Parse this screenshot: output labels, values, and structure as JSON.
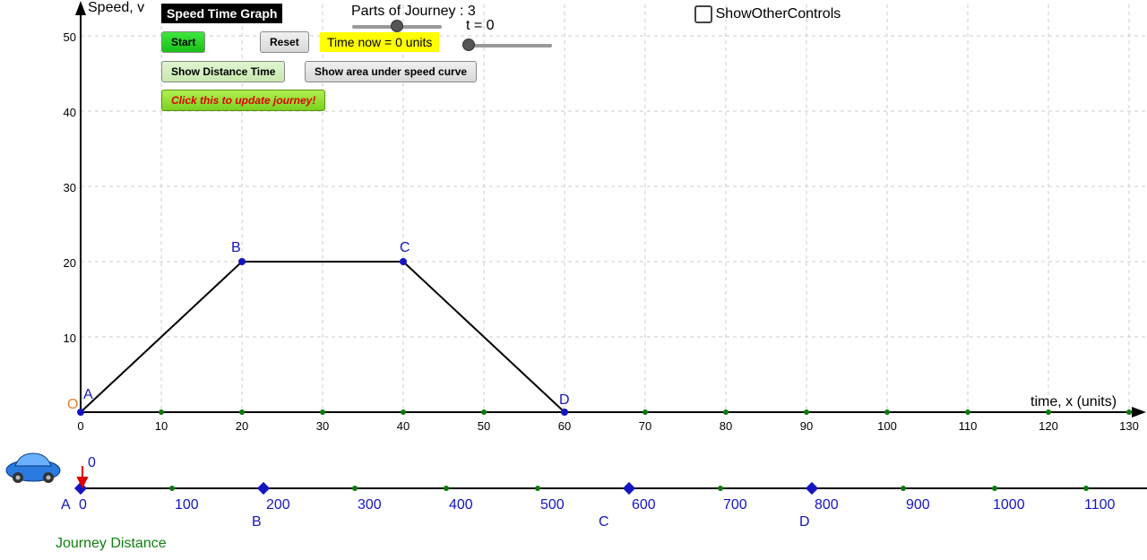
{
  "chart_data": {
    "type": "line",
    "title": "Speed Time Graph",
    "xlabel": "time,  x (units)",
    "ylabel": "Speed, v",
    "x": [
      0,
      20,
      40,
      60
    ],
    "values": [
      0,
      20,
      20,
      0
    ],
    "point_labels": [
      "A",
      "B",
      "C",
      "D"
    ],
    "xlim": [
      0,
      130
    ],
    "ylim": [
      0,
      50
    ],
    "xticks": [
      0,
      10,
      20,
      30,
      40,
      50,
      60,
      70,
      80,
      90,
      100,
      110,
      120,
      130
    ],
    "yticks": [
      10,
      20,
      30,
      40,
      50
    ],
    "origin_label": "O"
  },
  "controls": {
    "title": "Speed Time Graph",
    "start": "Start",
    "reset": "Reset",
    "time_now": "Time now = 0 units",
    "show_dist_time": "Show Distance Time",
    "show_area": "Show area under speed curve",
    "click_update": "Click this to update journey!",
    "parts_label": "Parts of Journey : 3",
    "t_label": "t = 0",
    "show_other": "ShowOtherControls"
  },
  "distance_axis": {
    "ticks": [
      0,
      100,
      200,
      300,
      400,
      500,
      600,
      700,
      800,
      900,
      1000,
      1100
    ],
    "current_pos": "0",
    "points": {
      "A": 0,
      "B": 200,
      "C": 600,
      "D": 800
    },
    "label": "Journey Distance"
  }
}
